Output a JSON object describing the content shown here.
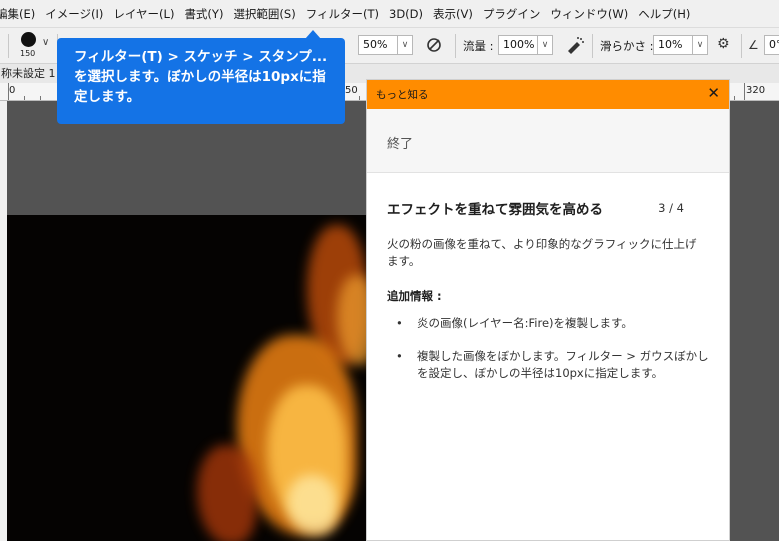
{
  "menu": [
    "編集(E)",
    "イメージ(I)",
    "レイヤー(L)",
    "書式(Y)",
    "選択範囲(S)",
    "フィルター(T)",
    "3D(D)",
    "表示(V)",
    "プラグイン",
    "ウィンドウ(W)",
    "ヘルプ(H)"
  ],
  "options": {
    "brush_size": "150",
    "opacity_value": "50%",
    "flow_label": "流量 :",
    "flow_value": "100%",
    "smoothing_label": "滑らかさ :",
    "smoothing_value": "10%",
    "angle_value": "0°"
  },
  "document": {
    "tab_label": "称未設定 1"
  },
  "ruler": {
    "labels": [
      "0",
      "50",
      "320"
    ]
  },
  "tooltip": {
    "text": "フィルター(T) > スケッチ > スタンプ...を選択します。ぼかしの半径は10pxに指定します。"
  },
  "panel": {
    "header_title": "もっと知る",
    "end_label": "終了",
    "step_title": "エフェクトを重ねて雰囲気を高める",
    "step_count": "3 / 4",
    "description": "火の粉の画像を重ねて、より印象的なグラフィックに仕上げます。",
    "extra_title": "追加情報 :",
    "bullets": [
      "炎の画像(レイヤー名:Fire)を複製します。",
      "複製した画像をぼかします。フィルター > ガウスぼかしを設定し、ぼかしの半径は10pxに指定します。"
    ]
  },
  "colors": {
    "accent_orange": "#ff8c00",
    "tooltip_blue": "#1473e6"
  }
}
